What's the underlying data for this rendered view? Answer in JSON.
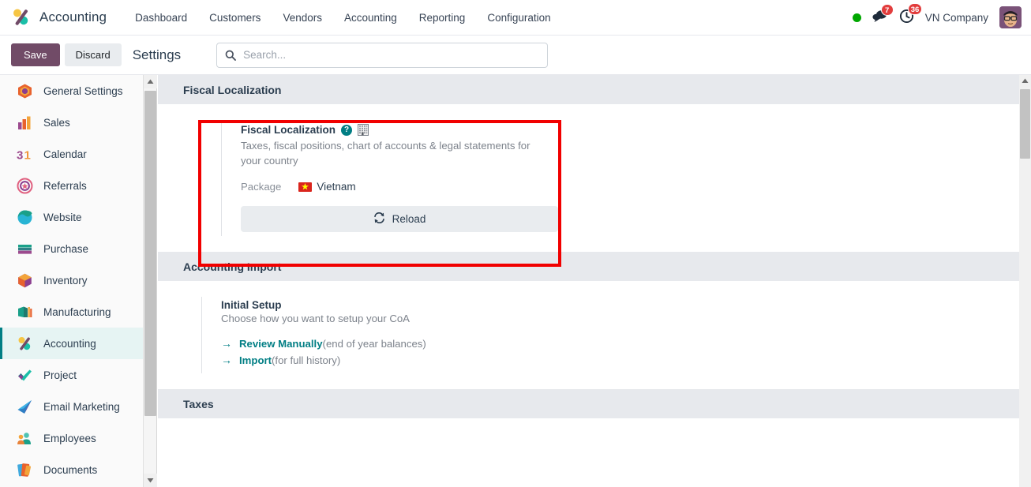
{
  "navbar": {
    "app_logo_name": "accounting-logo-icon",
    "app_name": "Accounting",
    "menu_items": [
      {
        "label": "Dashboard"
      },
      {
        "label": "Customers"
      },
      {
        "label": "Vendors"
      },
      {
        "label": "Accounting"
      },
      {
        "label": "Reporting"
      },
      {
        "label": "Configuration"
      }
    ],
    "status_indicator": "online-dot",
    "messages": {
      "icon": "chat-bubble-icon",
      "count": "7"
    },
    "activities": {
      "icon": "clock-icon",
      "count": "36"
    },
    "company": "VN Company",
    "avatar": "user-avatar"
  },
  "control_panel": {
    "save_label": "Save",
    "discard_label": "Discard",
    "title": "Settings",
    "search": {
      "placeholder": "Search...",
      "value": "",
      "icon": "search-icon"
    }
  },
  "sidebar": {
    "items": [
      {
        "label": "General Settings",
        "icon": "settings-app-icon",
        "active": false
      },
      {
        "label": "Sales",
        "icon": "sales-app-icon",
        "active": false
      },
      {
        "label": "Calendar",
        "icon": "calendar-app-icon",
        "active": false
      },
      {
        "label": "Referrals",
        "icon": "referrals-app-icon",
        "active": false
      },
      {
        "label": "Website",
        "icon": "website-app-icon",
        "active": false
      },
      {
        "label": "Purchase",
        "icon": "purchase-app-icon",
        "active": false
      },
      {
        "label": "Inventory",
        "icon": "inventory-app-icon",
        "active": false
      },
      {
        "label": "Manufacturing",
        "icon": "manufacturing-app-icon",
        "active": false
      },
      {
        "label": "Accounting",
        "icon": "accounting-app-icon",
        "active": true
      },
      {
        "label": "Project",
        "icon": "project-app-icon",
        "active": false
      },
      {
        "label": "Email Marketing",
        "icon": "email-marketing-app-icon",
        "active": false
      },
      {
        "label": "Employees",
        "icon": "employees-app-icon",
        "active": false
      },
      {
        "label": "Documents",
        "icon": "documents-app-icon",
        "active": false
      }
    ]
  },
  "main": {
    "sections": [
      {
        "id": "fiscal-localization",
        "header": "Fiscal Localization",
        "card": {
          "title": "Fiscal Localization",
          "help_icon": "help-question-icon",
          "company_icon": "building-icon",
          "description": "Taxes, fiscal positions, chart of accounts & legal statements for your country",
          "package_label": "Package",
          "package_value": "Vietnam",
          "package_flag": "vietnam-flag-icon",
          "reload_label": "Reload",
          "reload_icon": "refresh-icon"
        }
      },
      {
        "id": "accounting-import",
        "header": "Accounting Import",
        "block": {
          "title": "Initial Setup",
          "description": "Choose how you want to setup your CoA",
          "links": [
            {
              "arrow": "arrow-right-icon",
              "text": "Review Manually",
              "note": "(end of year balances)"
            },
            {
              "arrow": "arrow-right-icon",
              "text": "Import",
              "note": "(for full history)"
            }
          ]
        }
      },
      {
        "id": "taxes",
        "header": "Taxes"
      }
    ]
  },
  "colors": {
    "brand_purple": "#714b67",
    "accent_teal": "#017e84",
    "highlight_red": "#f10000",
    "badge_red": "#e23d3d",
    "online_green": "#00a700",
    "section_header_bg": "#e7e9ed"
  }
}
